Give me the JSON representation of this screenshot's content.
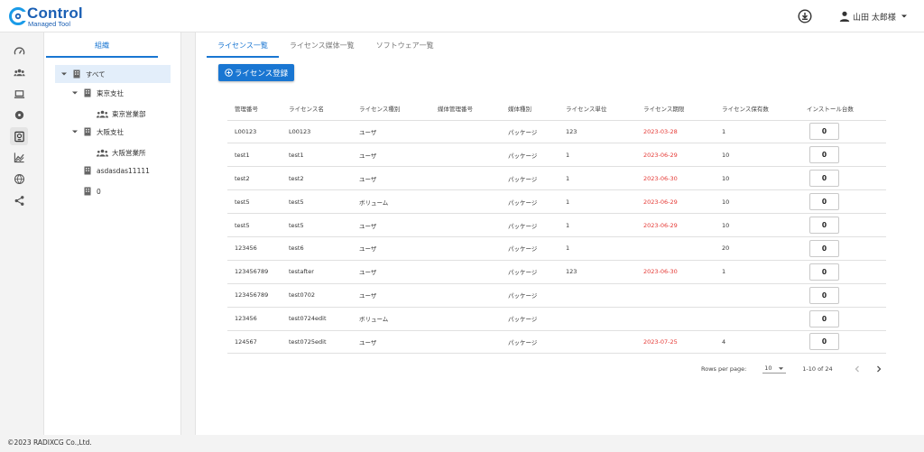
{
  "app": {
    "title": "Control",
    "subtitle": "Managed Tool",
    "brand_color": "#1a5fb4",
    "accent_color": "#1976d2"
  },
  "header": {
    "user_name": "山田 太郎様",
    "download_icon": "download-circle-icon",
    "user_icon": "person-icon"
  },
  "rail": {
    "items": [
      {
        "icon": "speedometer-icon",
        "active": false
      },
      {
        "icon": "users-group-icon",
        "active": false
      },
      {
        "icon": "laptop-icon",
        "active": false
      },
      {
        "icon": "disc-icon",
        "active": false
      },
      {
        "icon": "license-badge-icon",
        "active": true
      },
      {
        "icon": "chart-line-icon",
        "active": false
      },
      {
        "icon": "globe-download-icon",
        "active": false
      },
      {
        "icon": "share-icon",
        "active": false
      }
    ]
  },
  "tree": {
    "tab_label": "組織",
    "nodes": [
      {
        "label": "すべて",
        "level": 0,
        "icon": "building-icon",
        "expanded": true,
        "selected": true
      },
      {
        "label": "東京支社",
        "level": 1,
        "icon": "building-icon",
        "expanded": true
      },
      {
        "label": "東京営業部",
        "level": 2,
        "icon": "group-icon"
      },
      {
        "label": "大阪支社",
        "level": 1,
        "icon": "building-icon",
        "expanded": true
      },
      {
        "label": "大阪営業所",
        "level": 2,
        "icon": "group-icon"
      },
      {
        "label": "asdasdas11111",
        "level": 1,
        "icon": "building-icon"
      },
      {
        "label": "0",
        "level": 1,
        "icon": "building-icon"
      }
    ]
  },
  "main": {
    "tabs": [
      {
        "label": "ライセンス一覧",
        "active": true
      },
      {
        "label": "ライセンス媒体一覧",
        "active": false
      },
      {
        "label": "ソフトウェア一覧",
        "active": false
      }
    ],
    "register_button": "ライセンス登録",
    "table": {
      "columns": [
        "管理番号",
        "ライセンス名",
        "ライセンス種別",
        "媒体管理番号",
        "媒体種別",
        "ライセンス単位",
        "ライセンス期限",
        "ライセンス保有数",
        "インストール台数"
      ],
      "rows": [
        [
          "L00123",
          "L00123",
          "ユーザ",
          "",
          "パッケージ",
          "123",
          "2023-03-28",
          "1",
          "0"
        ],
        [
          "test1",
          "test1",
          "ユーザ",
          "",
          "パッケージ",
          "1",
          "2023-06-29",
          "10",
          "0"
        ],
        [
          "test2",
          "test2",
          "ユーザ",
          "",
          "パッケージ",
          "1",
          "2023-06-30",
          "10",
          "0"
        ],
        [
          "test5",
          "test5",
          "ボリューム",
          "",
          "パッケージ",
          "1",
          "2023-06-29",
          "10",
          "0"
        ],
        [
          "test5",
          "test5",
          "ユーザ",
          "",
          "パッケージ",
          "1",
          "2023-06-29",
          "10",
          "0"
        ],
        [
          "123456",
          "test6",
          "ユーザ",
          "",
          "パッケージ",
          "1",
          "",
          "20",
          "0"
        ],
        [
          "123456789",
          "testafter",
          "ユーザ",
          "",
          "パッケージ",
          "123",
          "2023-06-30",
          "1",
          "0"
        ],
        [
          "123456789",
          "test0702",
          "ユーザ",
          "",
          "パッケージ",
          "",
          "",
          "",
          "0"
        ],
        [
          "123456",
          "test0724edit",
          "ボリューム",
          "",
          "パッケージ",
          "",
          "",
          "",
          "0"
        ],
        [
          "124567",
          "test0725edit",
          "ユーザ",
          "",
          "パッケージ",
          "",
          "2023-07-25",
          "4",
          "0"
        ]
      ],
      "expiry_color": "#e53935"
    },
    "pagination": {
      "rows_per_page_label": "Rows per page:",
      "rows_per_page": "10",
      "range": "1-10 of 24"
    }
  },
  "footer": {
    "copyright": "©2023 RADIXCG Co.,Ltd."
  }
}
